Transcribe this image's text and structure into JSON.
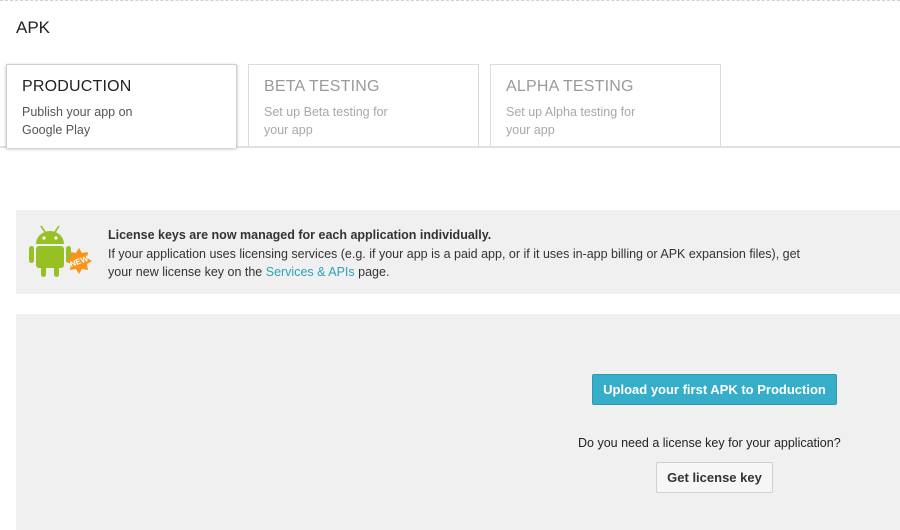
{
  "page": {
    "title": "APK"
  },
  "tabs": [
    {
      "title": "PRODUCTION",
      "description": "Publish your app on Google Play",
      "active": true
    },
    {
      "title": "BETA TESTING",
      "description": "Set up Beta testing for your app",
      "active": false
    },
    {
      "title": "ALPHA TESTING",
      "description": "Set up Alpha testing for your app",
      "active": false
    }
  ],
  "notice": {
    "icon": "android-new-icon",
    "badge": "NEW",
    "headline": "License keys are now managed for each application individually.",
    "body_before_link": "If your application uses licensing services (e.g. if your app is a paid app, or if it uses in-app billing or APK expansion files), get your new license key on the ",
    "link_text": "Services & APIs",
    "body_after_link": " page."
  },
  "panel": {
    "upload_button": "Upload your first APK to Production",
    "license_question": "Do you need a license key for your application?",
    "license_button": "Get license key"
  },
  "colors": {
    "accent": "#36aec9",
    "link": "#2aa2be",
    "android_green": "#97c024",
    "badge_orange": "#f7941d"
  }
}
